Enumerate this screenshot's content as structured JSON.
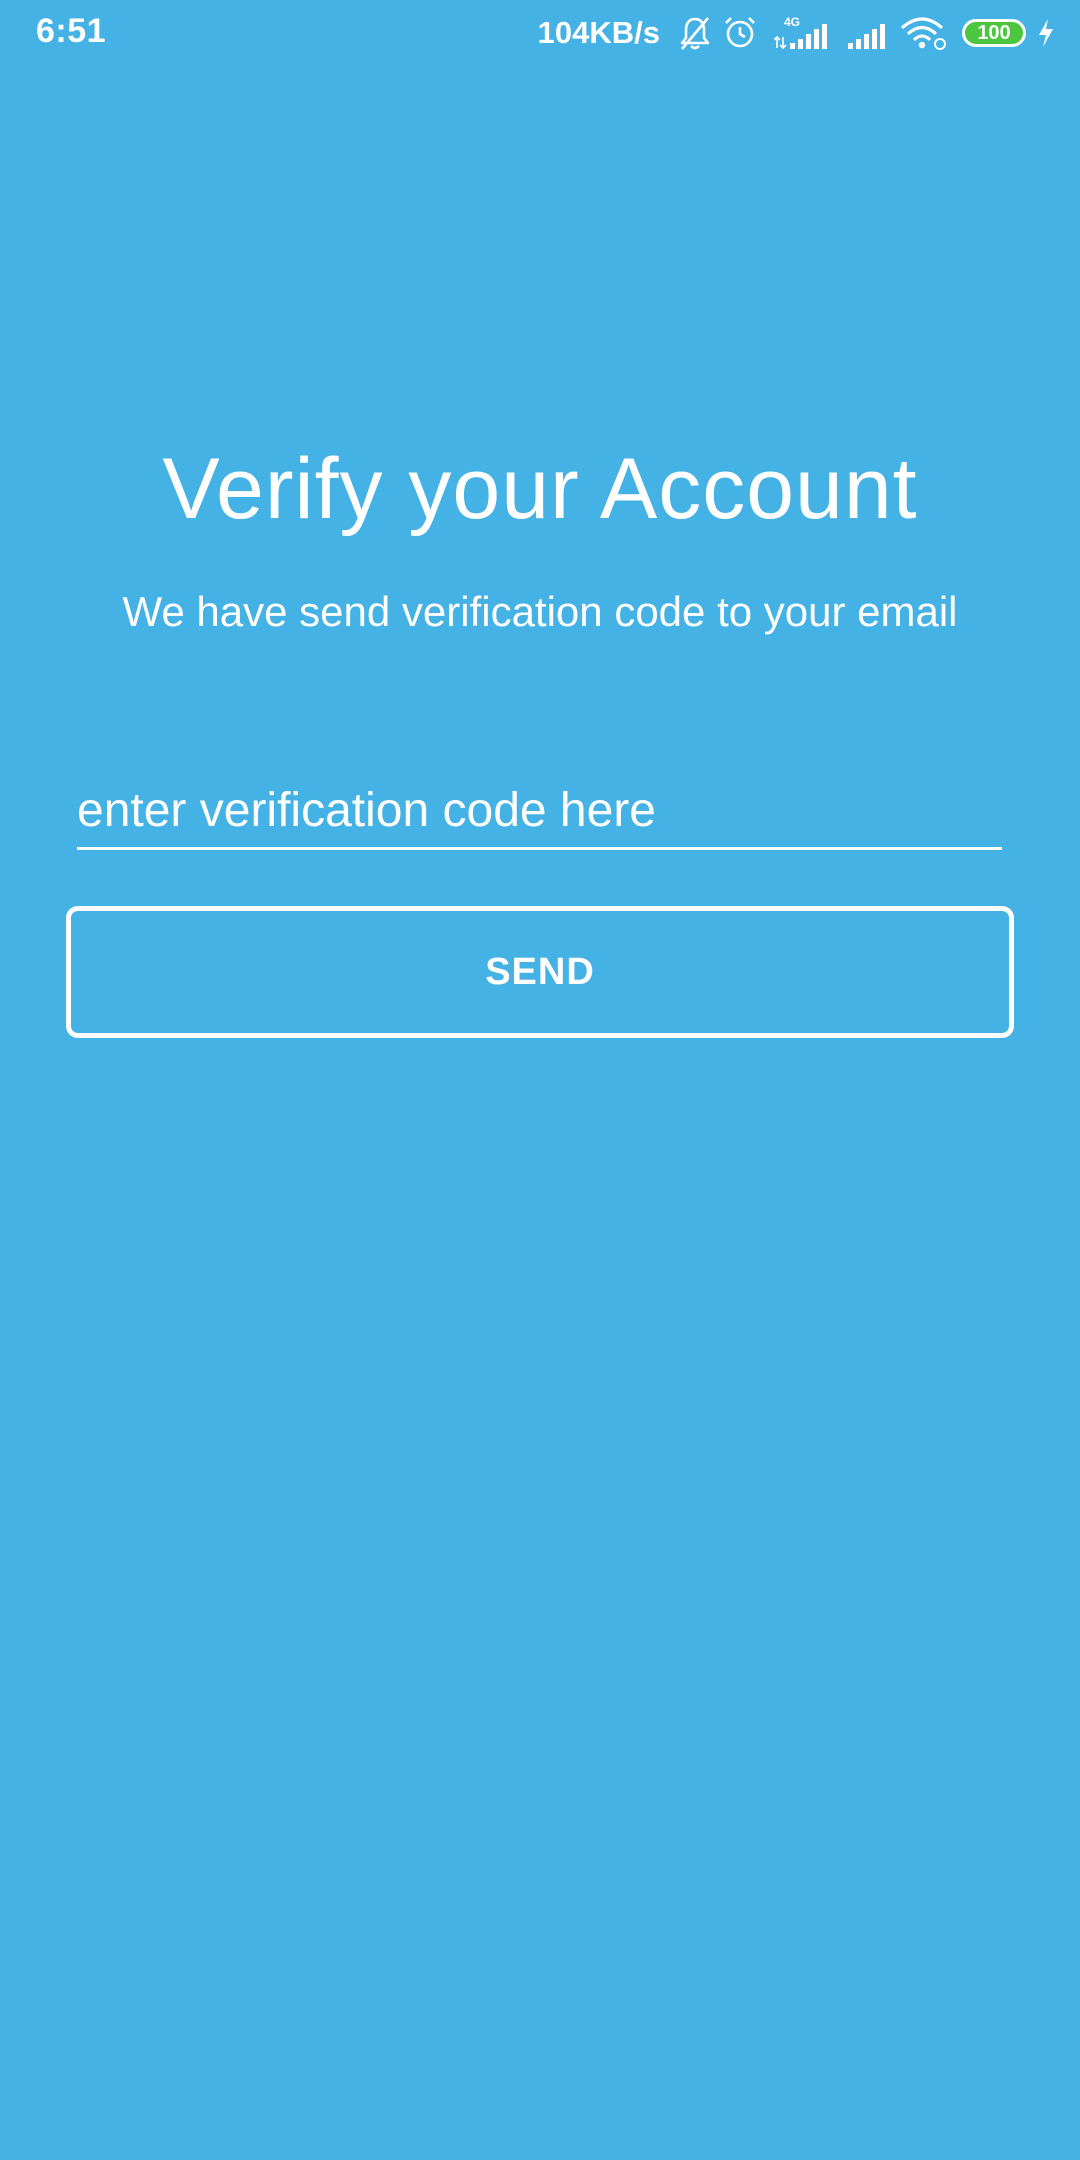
{
  "status_bar": {
    "time": "6:51",
    "net_speed": "104KB/s",
    "network_type": "4G",
    "battery_level": "100",
    "icons": [
      "bell-muted-icon",
      "alarm-icon",
      "signal-4g-icon",
      "signal-icon",
      "wifi-icon",
      "battery-icon",
      "charging-icon"
    ]
  },
  "screen": {
    "title": "Verify your Account",
    "subtitle": "We have send verification code to your email",
    "code_placeholder": "enter verification code here",
    "code_value": "",
    "send_label": "SEND"
  },
  "colors": {
    "background": "#45B2E5",
    "foreground": "#FFFFFF",
    "battery": "#4CC63E"
  }
}
